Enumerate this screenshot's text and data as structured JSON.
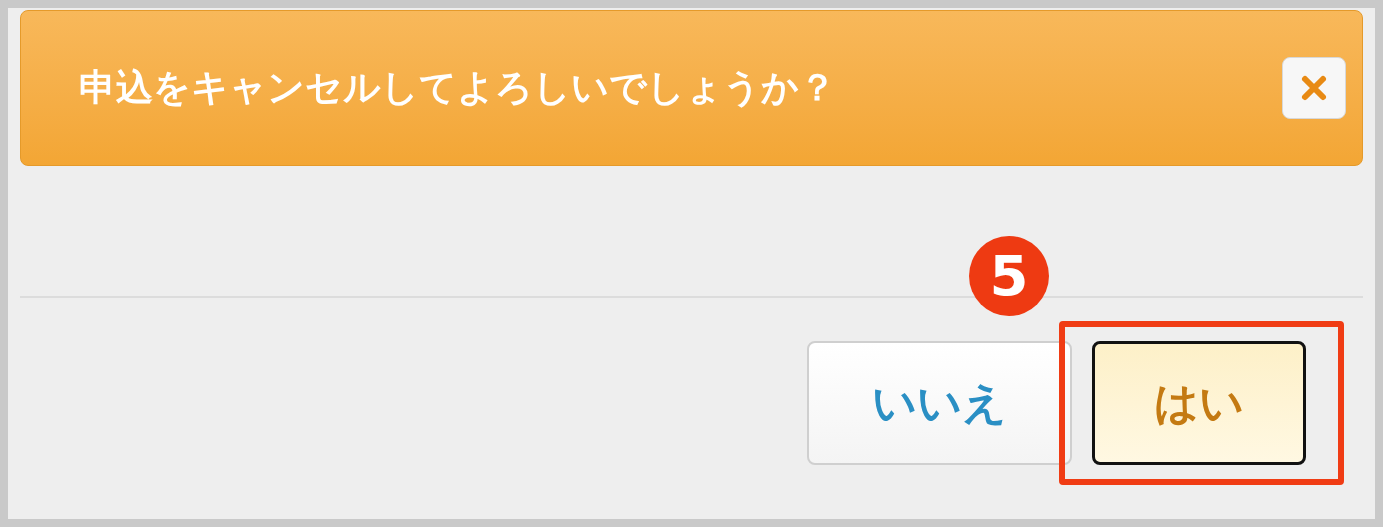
{
  "dialog": {
    "title": "申込をキャンセルしてよろしいでしょうか？"
  },
  "buttons": [
    {
      "label": "いいえ",
      "kind": "secondary",
      "highlighted": false
    },
    {
      "label": "はい",
      "kind": "primary",
      "highlighted": true
    }
  ],
  "annotation": {
    "step": "5"
  }
}
